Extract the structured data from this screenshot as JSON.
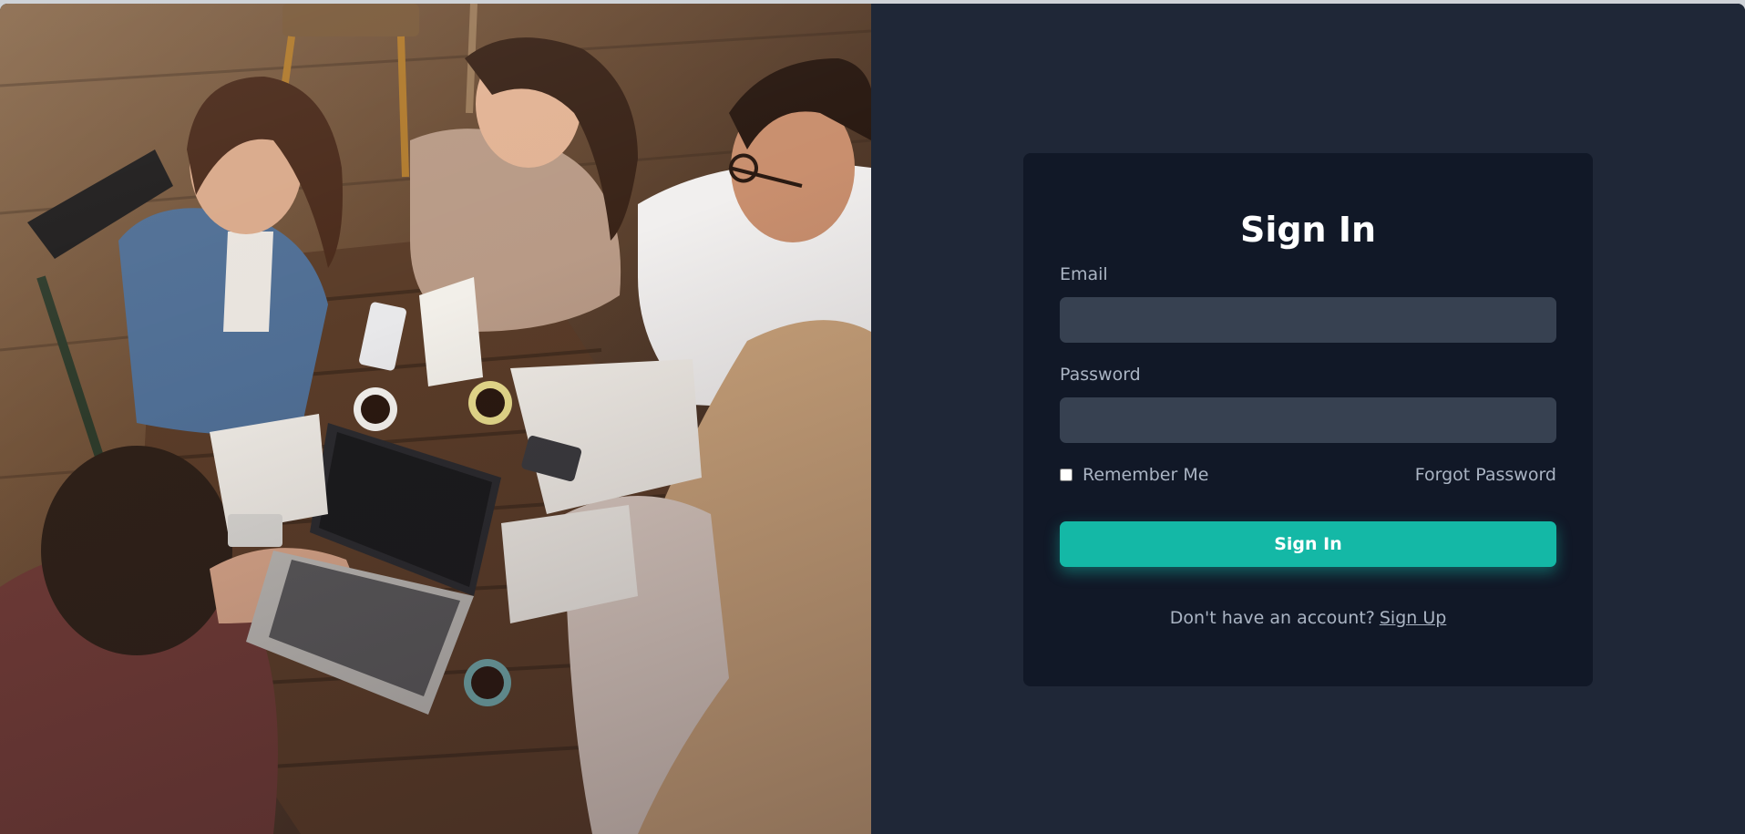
{
  "hero": {
    "image_description_icon": "photo-group-study-icon"
  },
  "signin": {
    "title": "Sign In",
    "email_label": "Email",
    "email_value": "",
    "password_label": "Password",
    "password_value": "",
    "remember_label": "Remember Me",
    "remember_checked": false,
    "forgot_label": "Forgot Password",
    "submit_label": "Sign In",
    "signup_prompt": "Don't have an account?",
    "signup_link": "Sign Up"
  },
  "colors": {
    "page_bg": "#1f2737",
    "card_bg": "#111827",
    "input_bg": "#374151",
    "accent": "#14b8a6",
    "muted_text": "#aab4c3"
  }
}
